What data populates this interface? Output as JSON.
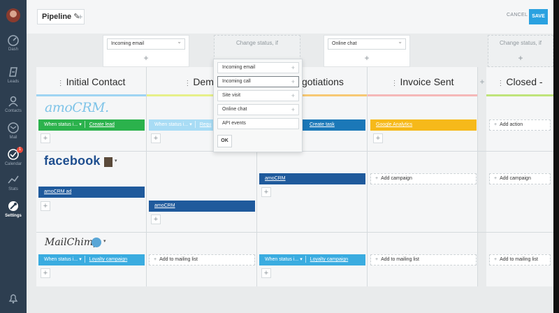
{
  "pipeline": {
    "title": "Pipeline",
    "cancel_label": "CANCEL",
    "save_label": "SAVE",
    "add_tab": "+"
  },
  "sidebar": {
    "items": [
      {
        "label": "Dash",
        "icon": "dashboard-icon"
      },
      {
        "label": "Leads",
        "icon": "leads-icon"
      },
      {
        "label": "Contacts",
        "icon": "contacts-icon"
      },
      {
        "label": "Mail",
        "icon": "mail-icon"
      },
      {
        "label": "Calendar",
        "icon": "calendar-icon",
        "badge": "1"
      },
      {
        "label": "Stats",
        "icon": "stats-icon"
      },
      {
        "label": "Settings",
        "icon": "settings-icon",
        "active": true
      }
    ]
  },
  "triggers": {
    "col1": "Incoming email",
    "col2_placeholder": "Change status, if",
    "col3": "Online chat",
    "col5_placeholder": "Change status, if"
  },
  "columns": [
    "Initial Contact",
    "Demo",
    "Negotiations",
    "Invoice Sent",
    "Closed -"
  ],
  "rows": {
    "amocrm": {
      "logo": "amoCRM.",
      "c1_status": "When status i...",
      "c1_action": "Create lead",
      "c2_status": "When status i...",
      "c2_action": "Requ",
      "c3_action": "Create task",
      "c4_action": "Google Analytics",
      "c5_action": "Add action"
    },
    "facebook": {
      "logo": "facebook",
      "c1_action": "amoCRM ad",
      "c2_action": "amoCRM",
      "c3_action": "amoCRM",
      "c4_action": "Add campaign",
      "c5_action": "Add campaign"
    },
    "mailchimp": {
      "logo": "MailChimp",
      "c1_status": "When status i...",
      "c1_action": "Loyalty campaign",
      "c2_action": "Add to mailing list",
      "c3_status": "When status i...",
      "c3_action": "Loyalty campaign",
      "c4_action": "Add to mailing list",
      "c5_action": "Add to mailing list"
    }
  },
  "popup": {
    "options": [
      "Incoming email",
      "Incoming call",
      "Site visit",
      "Online chat",
      "API events"
    ],
    "ok_label": "OK"
  },
  "colors": {
    "sidebar": "#2d3e50",
    "save": "#2aa1e0",
    "green": "#2bb24c",
    "lightblue": "#a8dcf5",
    "darkblue": "#1f5a9c",
    "skyblue": "#3aace0",
    "amber": "#f6b91a"
  }
}
